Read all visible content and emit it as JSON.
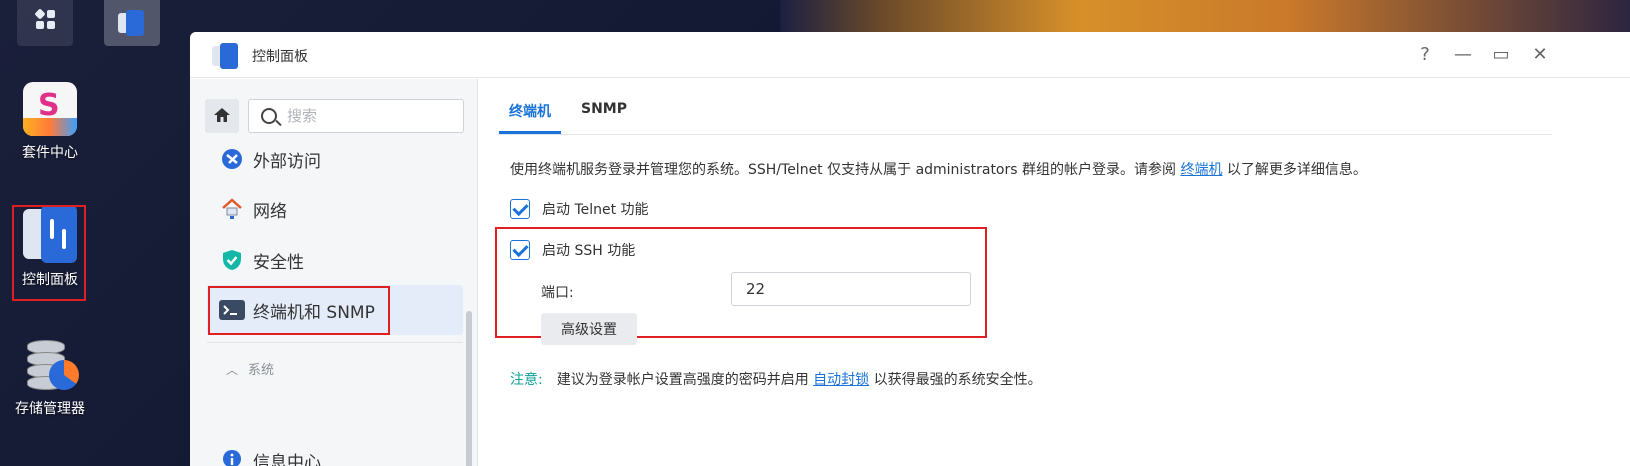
{
  "desktop": {
    "shortcuts": [
      {
        "label": "套件中心"
      },
      {
        "label": "控制面板"
      },
      {
        "label": "存储管理器"
      }
    ],
    "package_glyph": "S"
  },
  "window": {
    "title": "控制面板",
    "controls": {
      "help": "?",
      "minimize": "—",
      "maximize": "▭",
      "close": "✕"
    }
  },
  "sidebar": {
    "search_placeholder": "搜索",
    "items": [
      {
        "label": "外部访问"
      },
      {
        "label": "网络"
      },
      {
        "label": "安全性"
      },
      {
        "label": "终端机和 SNMP"
      },
      {
        "label": "信息中心"
      }
    ],
    "section_header": "系统"
  },
  "main": {
    "tabs": [
      {
        "label": "终端机"
      },
      {
        "label": "SNMP"
      }
    ],
    "description_before": "使用终端机服务登录并管理您的系统。SSH/Telnet 仅支持从属于 administrators 群组的帐户登录。请参阅 ",
    "description_link": "终端机",
    "description_after": " 以了解更多详细信息。",
    "telnet_label": "启动 Telnet 功能",
    "ssh_label": "启动 SSH 功能",
    "port_label": "端口:",
    "port_value": "22",
    "advanced_label": "高级设置",
    "note_label": "注意:",
    "note_before": "建议为登录帐户设置高强度的密码并启用 ",
    "note_link": "自动封锁",
    "note_after": " 以获得最强的系统安全性。"
  },
  "colors": {
    "accent": "#1a73d9",
    "highlight": "#e02020",
    "note": "#12a09c"
  }
}
